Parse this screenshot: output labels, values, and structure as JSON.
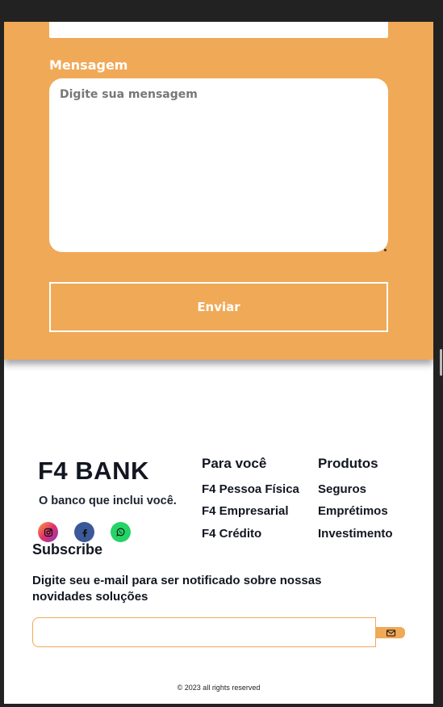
{
  "form": {
    "message_label": "Mensagem",
    "message_placeholder": "Digite sua mensagem",
    "submit_label": "Enviar"
  },
  "footer": {
    "brand": "F4 BANK",
    "tagline": "O banco que inclui você.",
    "social": [
      {
        "name": "instagram-icon",
        "color": "#E1306C"
      },
      {
        "name": "facebook-icon",
        "color": "#3B5998"
      },
      {
        "name": "whatsapp-icon",
        "color": "#25D366"
      }
    ],
    "columns": [
      {
        "title": "Para você",
        "links": [
          "F4 Pessoa Física",
          "F4 Empresarial",
          "F4 Crédito"
        ]
      },
      {
        "title": "Produtos",
        "links": [
          "Seguros",
          "Emprétimos",
          "Investimento"
        ]
      }
    ],
    "subscribe": {
      "title": "Subscribe",
      "text": "Digite seu e-mail para ser notificado sobre nossas novidades soluções",
      "email_value": "",
      "button_icon": "envelope-icon"
    },
    "copyright": "© 2023 all rights reserved"
  },
  "colors": {
    "accent": "#F0A957",
    "text": "#121621",
    "background": "#FFFFFF"
  }
}
